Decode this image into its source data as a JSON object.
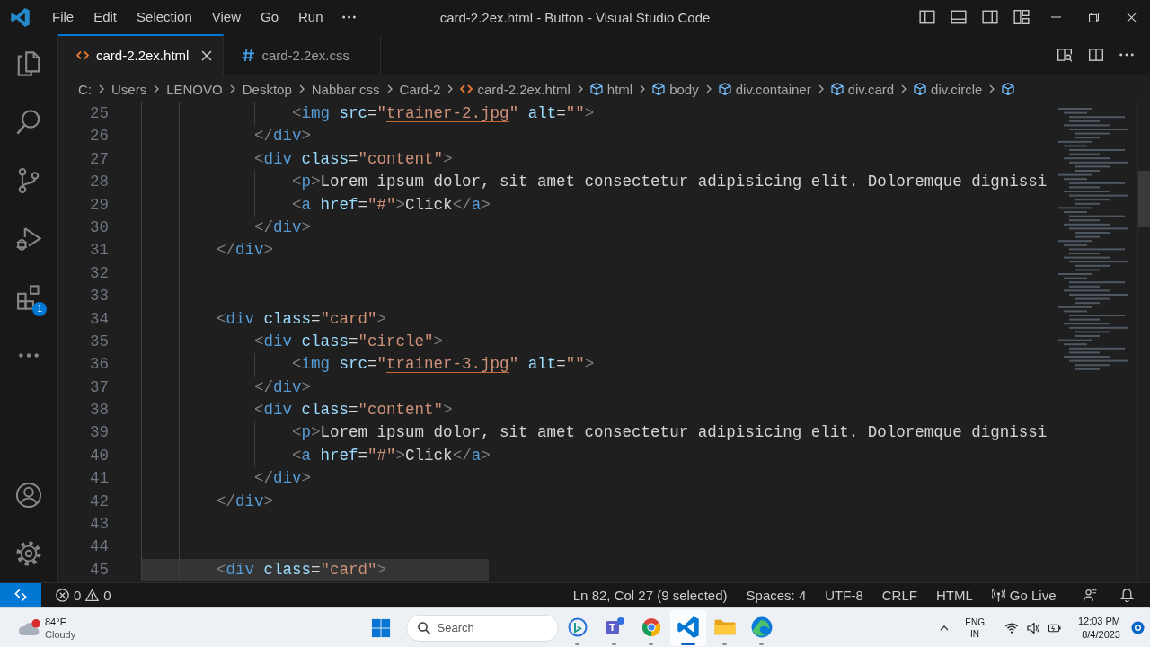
{
  "title_bar": {
    "menu": [
      "File",
      "Edit",
      "Selection",
      "View",
      "Go",
      "Run"
    ],
    "title": "card-2.2ex.html - Button - Visual Studio Code"
  },
  "activity_bar": {
    "top": [
      {
        "kind": "explorer"
      },
      {
        "kind": "search"
      },
      {
        "kind": "source-control"
      },
      {
        "kind": "run"
      },
      {
        "kind": "extensions",
        "badge": "1"
      },
      {
        "kind": "more"
      }
    ],
    "bottom": [
      {
        "kind": "accounts"
      },
      {
        "kind": "settings"
      }
    ]
  },
  "tabs": [
    {
      "label": "card-2.2ex.html",
      "kind": "html",
      "selected": true
    },
    {
      "label": "card-2.2ex.css",
      "kind": "css",
      "selected": false
    }
  ],
  "breadcrumb": [
    {
      "label": "C:",
      "kind": "folder"
    },
    {
      "label": "Users",
      "kind": "folder"
    },
    {
      "label": "LENOVO",
      "kind": "folder"
    },
    {
      "label": "Desktop",
      "kind": "folder"
    },
    {
      "label": "Nabbar css",
      "kind": "folder"
    },
    {
      "label": "Card-2",
      "kind": "folder"
    },
    {
      "label": "card-2.2ex.html",
      "kind": "file"
    },
    {
      "label": "html",
      "kind": "symbol"
    },
    {
      "label": "body",
      "kind": "symbol"
    },
    {
      "label": "div.container",
      "kind": "symbol"
    },
    {
      "label": "div.card",
      "kind": "symbol"
    },
    {
      "label": "div.circle",
      "kind": "symbol"
    }
  ],
  "editor": {
    "lines": [
      {
        "number": "25",
        "highlighted": false,
        "tokens": [
          {
            "kind": "punct",
            "text": "                <"
          },
          {
            "kind": "tag",
            "text": "img"
          },
          {
            "kind": "attr",
            "text": " src"
          },
          {
            "kind": "eq",
            "text": "="
          },
          {
            "kind": "string",
            "text": "\""
          },
          {
            "kind": "link",
            "text": "trainer-2.jpg"
          },
          {
            "kind": "string",
            "text": "\""
          },
          {
            "kind": "attr",
            "text": " alt"
          },
          {
            "kind": "eq",
            "text": "="
          },
          {
            "kind": "string",
            "text": "\"\""
          },
          {
            "kind": "punct",
            "text": ">"
          }
        ]
      },
      {
        "number": "26",
        "highlighted": false,
        "tokens": [
          {
            "kind": "punct",
            "text": "            </"
          },
          {
            "kind": "tag",
            "text": "div"
          },
          {
            "kind": "punct",
            "text": ">"
          }
        ]
      },
      {
        "number": "27",
        "highlighted": false,
        "tokens": [
          {
            "kind": "punct",
            "text": "            <"
          },
          {
            "kind": "tag",
            "text": "div"
          },
          {
            "kind": "attr",
            "text": " class"
          },
          {
            "kind": "eq",
            "text": "="
          },
          {
            "kind": "string",
            "text": "\"content\""
          },
          {
            "kind": "punct",
            "text": ">"
          }
        ]
      },
      {
        "number": "28",
        "highlighted": false,
        "tokens": [
          {
            "kind": "punct",
            "text": "                <"
          },
          {
            "kind": "tag",
            "text": "p"
          },
          {
            "kind": "punct",
            "text": ">"
          },
          {
            "kind": "text",
            "text": "Lorem ipsum dolor, sit amet consectetur adipisicing elit. Doloremque dignissi"
          }
        ]
      },
      {
        "number": "29",
        "highlighted": false,
        "tokens": [
          {
            "kind": "punct",
            "text": "                <"
          },
          {
            "kind": "tag",
            "text": "a"
          },
          {
            "kind": "attr",
            "text": " href"
          },
          {
            "kind": "eq",
            "text": "="
          },
          {
            "kind": "string",
            "text": "\"#\""
          },
          {
            "kind": "punct",
            "text": ">"
          },
          {
            "kind": "text",
            "text": "Click"
          },
          {
            "kind": "punct",
            "text": "</"
          },
          {
            "kind": "tag",
            "text": "a"
          },
          {
            "kind": "punct",
            "text": ">"
          }
        ]
      },
      {
        "number": "30",
        "highlighted": false,
        "tokens": [
          {
            "kind": "punct",
            "text": "            </"
          },
          {
            "kind": "tag",
            "text": "div"
          },
          {
            "kind": "punct",
            "text": ">"
          }
        ]
      },
      {
        "number": "31",
        "highlighted": false,
        "tokens": [
          {
            "kind": "punct",
            "text": "        </"
          },
          {
            "kind": "tag",
            "text": "div"
          },
          {
            "kind": "punct",
            "text": ">"
          }
        ]
      },
      {
        "number": "32",
        "highlighted": false
      },
      {
        "number": "33",
        "highlighted": false
      },
      {
        "number": "34",
        "highlighted": false,
        "tokens": [
          {
            "kind": "punct",
            "text": "        <"
          },
          {
            "kind": "tag",
            "text": "div"
          },
          {
            "kind": "attr",
            "text": " class"
          },
          {
            "kind": "eq",
            "text": "="
          },
          {
            "kind": "string",
            "text": "\"card\""
          },
          {
            "kind": "punct",
            "text": ">"
          }
        ]
      },
      {
        "number": "35",
        "highlighted": false,
        "tokens": [
          {
            "kind": "punct",
            "text": "            <"
          },
          {
            "kind": "tag",
            "text": "div"
          },
          {
            "kind": "attr",
            "text": " class"
          },
          {
            "kind": "eq",
            "text": "="
          },
          {
            "kind": "string",
            "text": "\"circle\""
          },
          {
            "kind": "punct",
            "text": ">"
          }
        ]
      },
      {
        "number": "36",
        "highlighted": false,
        "tokens": [
          {
            "kind": "punct",
            "text": "                <"
          },
          {
            "kind": "tag",
            "text": "img"
          },
          {
            "kind": "attr",
            "text": " src"
          },
          {
            "kind": "eq",
            "text": "="
          },
          {
            "kind": "string",
            "text": "\""
          },
          {
            "kind": "link",
            "text": "trainer-3.jpg"
          },
          {
            "kind": "string",
            "text": "\""
          },
          {
            "kind": "attr",
            "text": " alt"
          },
          {
            "kind": "eq",
            "text": "="
          },
          {
            "kind": "string",
            "text": "\"\""
          },
          {
            "kind": "punct",
            "text": ">"
          }
        ]
      },
      {
        "number": "37",
        "highlighted": false,
        "tokens": [
          {
            "kind": "punct",
            "text": "            </"
          },
          {
            "kind": "tag",
            "text": "div"
          },
          {
            "kind": "punct",
            "text": ">"
          }
        ]
      },
      {
        "number": "38",
        "highlighted": false,
        "tokens": [
          {
            "kind": "punct",
            "text": "            <"
          },
          {
            "kind": "tag",
            "text": "div"
          },
          {
            "kind": "attr",
            "text": " class"
          },
          {
            "kind": "eq",
            "text": "="
          },
          {
            "kind": "string",
            "text": "\"content\""
          },
          {
            "kind": "punct",
            "text": ">"
          }
        ]
      },
      {
        "number": "39",
        "highlighted": false,
        "tokens": [
          {
            "kind": "punct",
            "text": "                <"
          },
          {
            "kind": "tag",
            "text": "p"
          },
          {
            "kind": "punct",
            "text": ">"
          },
          {
            "kind": "text",
            "text": "Lorem ipsum dolor, sit amet consectetur adipisicing elit. Doloremque dignissi"
          }
        ]
      },
      {
        "number": "40",
        "highlighted": false,
        "tokens": [
          {
            "kind": "punct",
            "text": "                <"
          },
          {
            "kind": "tag",
            "text": "a"
          },
          {
            "kind": "attr",
            "text": " href"
          },
          {
            "kind": "eq",
            "text": "="
          },
          {
            "kind": "string",
            "text": "\"#\""
          },
          {
            "kind": "punct",
            "text": ">"
          },
          {
            "kind": "text",
            "text": "Click"
          },
          {
            "kind": "punct",
            "text": "</"
          },
          {
            "kind": "tag",
            "text": "a"
          },
          {
            "kind": "punct",
            "text": ">"
          }
        ]
      },
      {
        "number": "41",
        "highlighted": false,
        "tokens": [
          {
            "kind": "punct",
            "text": "            </"
          },
          {
            "kind": "tag",
            "text": "div"
          },
          {
            "kind": "punct",
            "text": ">"
          }
        ]
      },
      {
        "number": "42",
        "highlighted": false,
        "tokens": [
          {
            "kind": "punct",
            "text": "        </"
          },
          {
            "kind": "tag",
            "text": "div"
          },
          {
            "kind": "punct",
            "text": ">"
          }
        ]
      },
      {
        "number": "43",
        "highlighted": false
      },
      {
        "number": "44",
        "highlighted": false
      },
      {
        "number": "45",
        "highlighted": true,
        "tokens": [
          {
            "kind": "punct",
            "text": "        <"
          },
          {
            "kind": "tag",
            "text": "div"
          },
          {
            "kind": "attr",
            "text": " class"
          },
          {
            "kind": "eq",
            "text": "="
          },
          {
            "kind": "string",
            "text": "\"card\""
          },
          {
            "kind": "punct",
            "text": ">"
          }
        ]
      }
    ]
  },
  "status_bar": {
    "problems": {
      "errors": "0",
      "warnings": "0"
    },
    "items": [
      {
        "kind": "text",
        "label": "Ln 82, Col 27 (9 selected)"
      },
      {
        "kind": "text",
        "label": "Spaces: 4"
      },
      {
        "kind": "text",
        "label": "UTF-8"
      },
      {
        "kind": "text",
        "label": "CRLF"
      },
      {
        "kind": "text",
        "label": "HTML"
      },
      {
        "kind": "go-live",
        "label": "Go Live"
      }
    ]
  },
  "taskbar": {
    "weather": {
      "temperature": "84°F",
      "condition": "Cloudy"
    },
    "search": {
      "placeholder": "Search"
    },
    "apps": [
      {
        "kind": "chat",
        "selected": false
      },
      {
        "kind": "meeting",
        "selected": false
      },
      {
        "kind": "chrome",
        "selected": false
      },
      {
        "kind": "code",
        "selected": true
      },
      {
        "kind": "folder",
        "selected": false
      },
      {
        "kind": "edge",
        "selected": false
      }
    ],
    "tray": {
      "language": "ENG",
      "region": "IN",
      "time": "12:03 PM",
      "date": "8/4/2023"
    }
  }
}
